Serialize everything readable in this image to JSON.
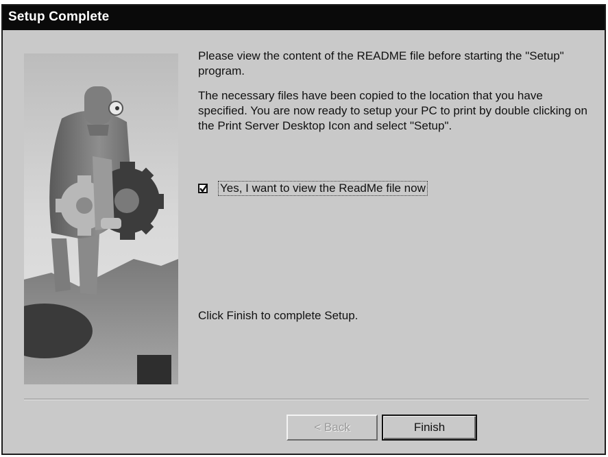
{
  "window": {
    "title": "Setup Complete"
  },
  "content": {
    "paragraph1": "Please view the content of the README file before starting the \"Setup\" program.",
    "paragraph2": "The necessary files have been copied to the location that you have specified. You are now ready to setup your PC to print by double clicking on the Print Server Desktop Icon and select \"Setup\".",
    "checkbox": {
      "label": "Yes, I want to view the ReadMe file now",
      "checked": true
    },
    "finish_instruction": "Click Finish to complete Setup."
  },
  "buttons": {
    "back_label": "< Back",
    "back_enabled": false,
    "finish_label": "Finish"
  },
  "colors": {
    "titlebar": "#0a0a0a",
    "dialog_background": "#c9c9c9"
  },
  "illustration": {
    "subject": "man holding gear wizard graphic"
  }
}
